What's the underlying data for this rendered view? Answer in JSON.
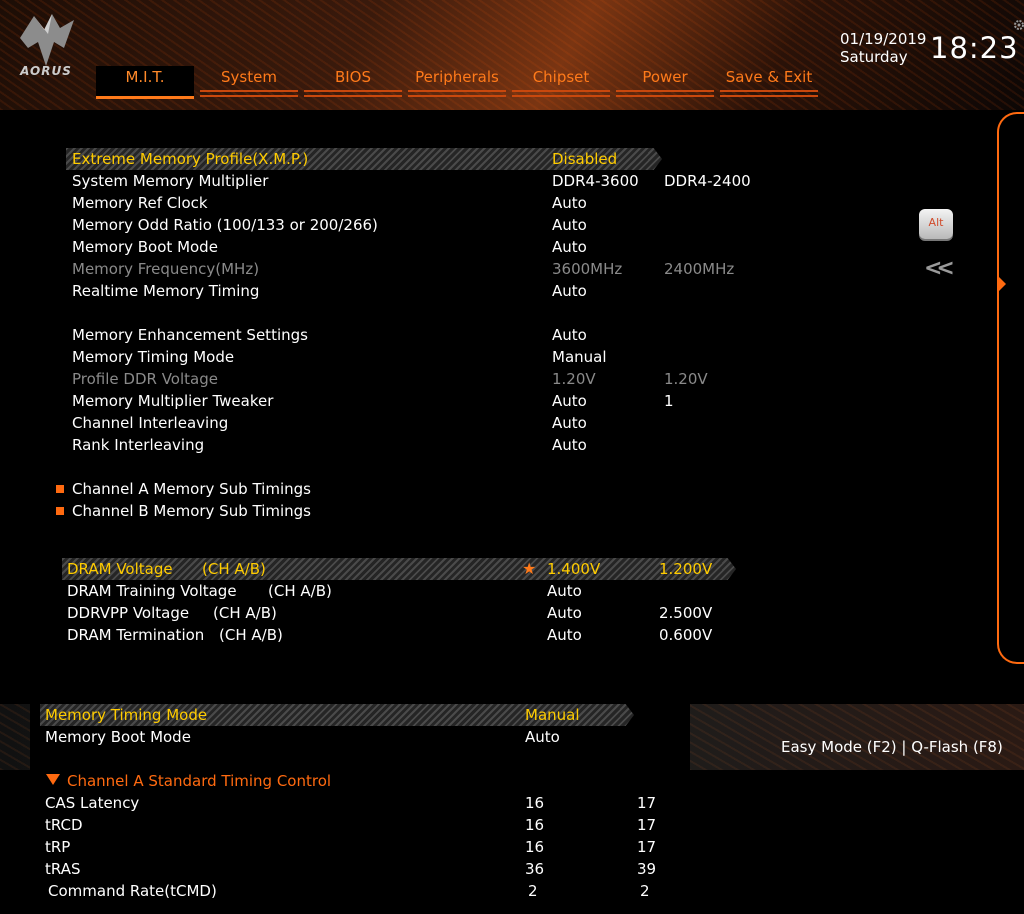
{
  "header": {
    "logo_text": "AORUS",
    "tabs": [
      {
        "label": "M.I.T.",
        "active": true
      },
      {
        "label": "System"
      },
      {
        "label": "BIOS"
      },
      {
        "label": "Peripherals"
      },
      {
        "label": "Chipset"
      },
      {
        "label": "Power"
      },
      {
        "label": "Save & Exit"
      }
    ],
    "date": "01/19/2019",
    "day": "Saturday",
    "time": "18:23"
  },
  "side": {
    "alt_key_label": "Alt"
  },
  "memory": {
    "xmp": {
      "label": "Extreme Memory Profile(X.M.P.)",
      "value": "Disabled"
    },
    "multiplier": {
      "label": "System Memory Multiplier",
      "value": "DDR4-3600",
      "value2": "DDR4-2400"
    },
    "ref_clock": {
      "label": "Memory Ref Clock",
      "value": "Auto"
    },
    "odd_ratio": {
      "label": "Memory Odd Ratio (100/133 or 200/266)",
      "value": "Auto"
    },
    "boot_mode": {
      "label": "Memory Boot Mode",
      "value": "Auto"
    },
    "frequency": {
      "label": "Memory Frequency(MHz)",
      "value": "3600MHz",
      "value2": "2400MHz"
    },
    "realtime": {
      "label": "Realtime Memory Timing",
      "value": "Auto"
    },
    "enhancement": {
      "label": "Memory Enhancement Settings",
      "value": "Auto"
    },
    "timing_mode": {
      "label": "Memory Timing Mode",
      "value": "Manual"
    },
    "profile_voltage": {
      "label": "Profile DDR Voltage",
      "value": "1.20V",
      "value2": "1.20V"
    },
    "mult_tweaker": {
      "label": "Memory Multiplier Tweaker",
      "value": "Auto",
      "value2": "1"
    },
    "channel_interleave": {
      "label": "Channel Interleaving",
      "value": "Auto"
    },
    "rank_interleave": {
      "label": "Rank Interleaving",
      "value": "Auto"
    },
    "sub_a": "Channel A Memory Sub Timings",
    "sub_b": "Channel B Memory Sub Timings"
  },
  "voltage": {
    "dram": {
      "label": "DRAM Voltage",
      "ch": "(CH A/B)",
      "value": "1.400V",
      "value2": "1.200V"
    },
    "training": {
      "label": "DRAM Training Voltage",
      "ch": "(CH A/B)",
      "value": "Auto"
    },
    "ddrvpp": {
      "label": "DDRVPP Voltage",
      "ch": "(CH A/B)",
      "value": "Auto",
      "value2": "2.500V"
    },
    "termination": {
      "label": "DRAM Termination",
      "ch": "(CH A/B)",
      "value": "Auto",
      "value2": "0.600V"
    }
  },
  "bottom": {
    "timing_mode": {
      "label": "Memory Timing Mode",
      "value": "Manual"
    },
    "boot_mode": {
      "label": "Memory Boot Mode",
      "value": "Auto"
    },
    "section_title": "Channel A Standard Timing Control",
    "rows": [
      {
        "label": "CAS Latency",
        "value": "16",
        "value2": "17"
      },
      {
        "label": "tRCD",
        "value": "16",
        "value2": "17"
      },
      {
        "label": "tRP",
        "value": "16",
        "value2": "17"
      },
      {
        "label": "tRAS",
        "value": "36",
        "value2": "39"
      },
      {
        "label": "Command Rate(tCMD)",
        "value": "2",
        "value2": "2"
      }
    ],
    "hotkeys": "Easy Mode (F2)  |  Q-Flash (F8)"
  }
}
